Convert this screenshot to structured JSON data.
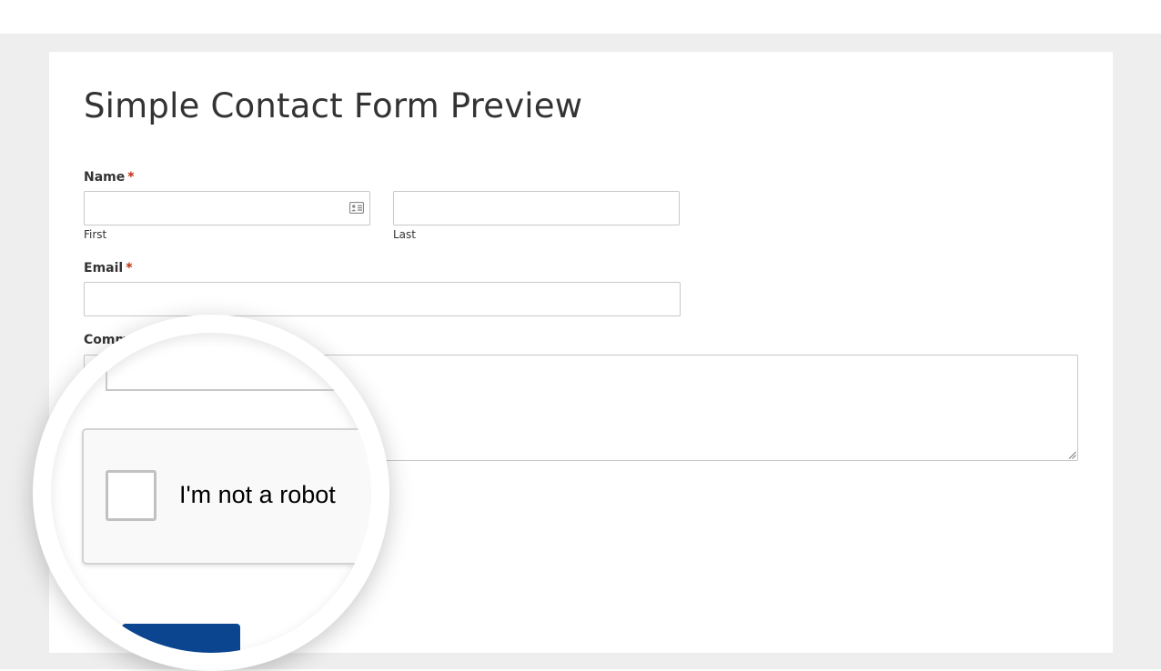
{
  "page": {
    "title": "Simple Contact Form Preview"
  },
  "form": {
    "name_label": "Name",
    "name_required": "*",
    "first_sublabel": "First",
    "last_sublabel": "Last",
    "email_label": "Email",
    "email_required": "*",
    "comment_label": "Comm"
  },
  "recaptcha": {
    "label": "I'm not a robot"
  },
  "colors": {
    "page_background": "#eeeeee",
    "required_star": "#c02b0a",
    "submit_button": "#0b4590"
  },
  "icons": {
    "first_name_field": "contact-card-icon",
    "textarea": "resize-handle-icon"
  }
}
